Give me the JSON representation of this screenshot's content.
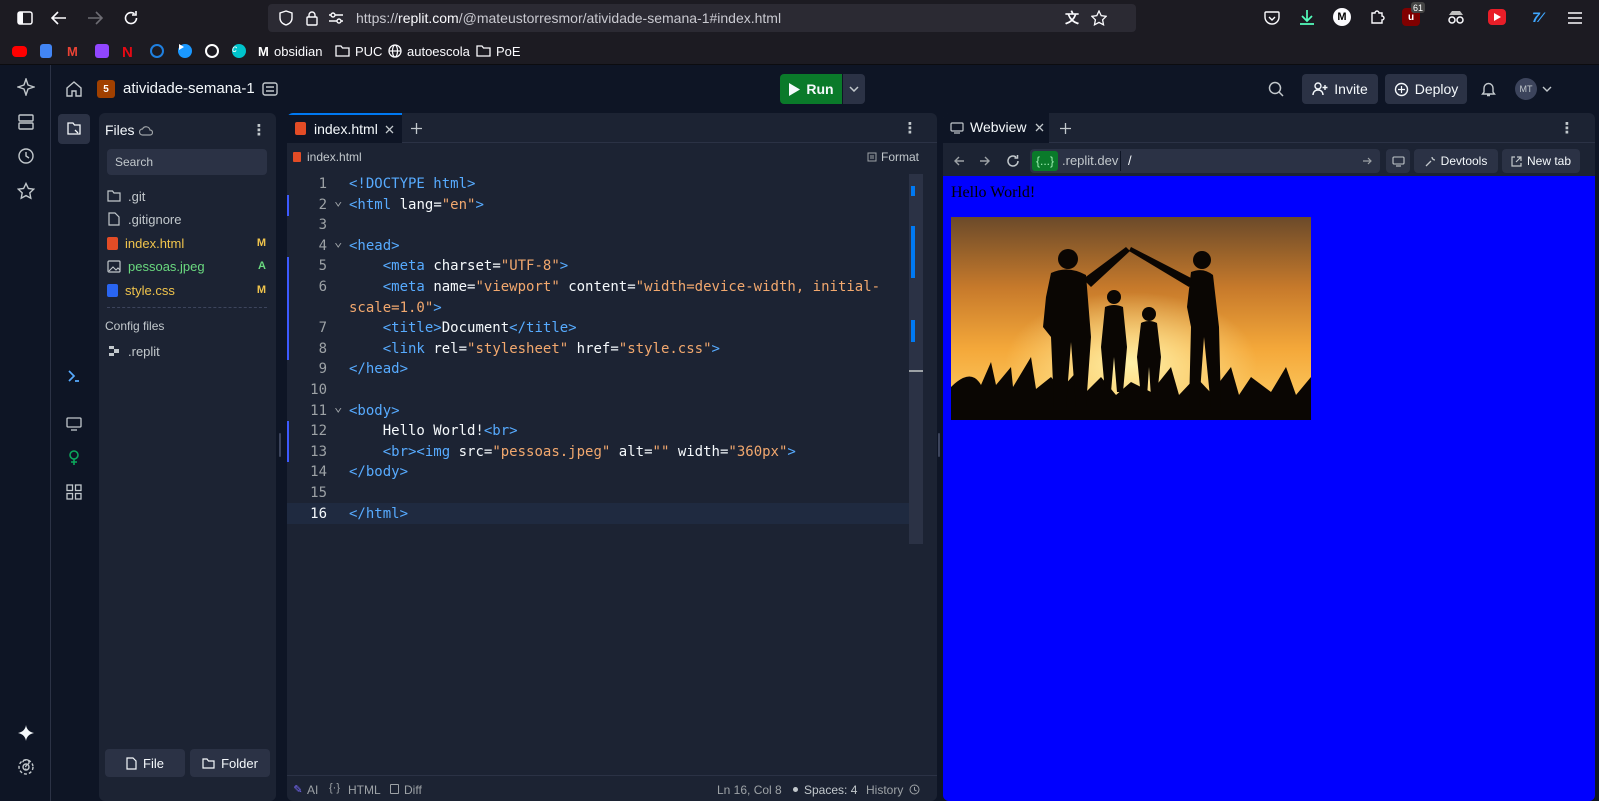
{
  "browser": {
    "url_prefix": "https://",
    "url_host": "replit.com",
    "url_path": "/@mateustorresmor/atividade-semana-1#index.html",
    "notification_count": "61",
    "bookmarks": [
      {
        "label": "",
        "icon": "youtube-icon",
        "color": "#ff0000"
      },
      {
        "label": "",
        "icon": "docs-icon",
        "color": "#4285f4"
      },
      {
        "label": "",
        "icon": "gmail-icon",
        "color": "#ea4335"
      },
      {
        "label": "",
        "icon": "twitch-icon",
        "color": "#9146ff"
      },
      {
        "label": "",
        "icon": "netflix-icon",
        "color": "#e50914"
      },
      {
        "label": "",
        "icon": "disney-icon",
        "color": "#1f80e0"
      },
      {
        "label": "",
        "icon": "prime-icon",
        "color": "#1a98ff"
      },
      {
        "label": "",
        "icon": "openai-icon",
        "color": "#ffffff"
      },
      {
        "label": "",
        "icon": "canva-icon",
        "color": "#00c4cc"
      },
      {
        "label": "obsidian",
        "icon": "medium-icon",
        "color": "#ffffff"
      },
      {
        "label": "PUC",
        "icon": "folder-icon",
        "color": "#fbfbfe"
      },
      {
        "label": "autoescola",
        "icon": "globe-icon",
        "color": "#fbfbfe"
      },
      {
        "label": "PoE",
        "icon": "folder-icon",
        "color": "#fbfbfe"
      }
    ]
  },
  "topbar": {
    "repl_name": "atividade-semana-1",
    "run_label": "Run",
    "invite_label": "Invite",
    "deploy_label": "Deploy",
    "avatar_initials": "MT"
  },
  "files": {
    "title": "Files",
    "search_placeholder": "Search",
    "items": [
      {
        "name": ".git",
        "badge": "",
        "color": "#c2c8cc",
        "icon": "folder-icon"
      },
      {
        "name": ".gitignore",
        "badge": "",
        "color": "#c2c8cc",
        "icon": "file-icon"
      },
      {
        "name": "index.html",
        "badge": "M",
        "color": "#f0c44c",
        "icon": "html-icon"
      },
      {
        "name": "pessoas.jpeg",
        "badge": "A",
        "color": "#6ad97f",
        "icon": "image-icon"
      },
      {
        "name": "style.css",
        "badge": "M",
        "color": "#f0c44c",
        "icon": "css-icon"
      }
    ],
    "config_title": "Config files",
    "config_items": [
      {
        "name": ".replit"
      }
    ],
    "new_file_label": "File",
    "new_folder_label": "Folder"
  },
  "editor": {
    "tab_label": "index.html",
    "breadcrumb": "index.html",
    "format_label": "Format",
    "status": {
      "ai": "AI",
      "lang": "HTML",
      "diff": "Diff",
      "position": "Ln 16, Col 8",
      "spaces": "Spaces: 4",
      "history": "History"
    },
    "lines": [
      {
        "n": "1",
        "html": "<span class=\"t\">&lt;!DOCTYPE html&gt;</span>"
      },
      {
        "n": "2",
        "fold": true,
        "html": "<span class=\"t\">&lt;html</span> <span class=\"a\">lang</span>=<span class=\"s\">\"en\"</span><span class=\"t\">&gt;</span>"
      },
      {
        "n": "3",
        "html": ""
      },
      {
        "n": "4",
        "fold": true,
        "html": "<span class=\"t\">&lt;head&gt;</span>"
      },
      {
        "n": "5",
        "html": "    <span class=\"t\">&lt;meta</span> <span class=\"a\">charset</span>=<span class=\"s\">\"UTF-8\"</span><span class=\"t\">&gt;</span>"
      },
      {
        "n": "6",
        "html": "    <span class=\"t\">&lt;meta</span> <span class=\"a\">name</span>=<span class=\"s\">\"viewport\"</span> <span class=\"a\">content</span>=<span class=\"s\">\"width=device-width, initial-</span>"
      },
      {
        "n": "",
        "html": "<span class=\"s\">scale=1.0\"</span><span class=\"t\">&gt;</span>"
      },
      {
        "n": "7",
        "html": "    <span class=\"t\">&lt;title&gt;</span>Document<span class=\"t\">&lt;/title&gt;</span>"
      },
      {
        "n": "8",
        "html": "    <span class=\"t\">&lt;link</span> <span class=\"a\">rel</span>=<span class=\"s\">\"stylesheet\"</span> <span class=\"a\">href</span>=<span class=\"s\">\"style.css\"</span><span class=\"t\">&gt;</span>"
      },
      {
        "n": "9",
        "html": "<span class=\"t\">&lt;/head&gt;</span>"
      },
      {
        "n": "10",
        "html": ""
      },
      {
        "n": "11",
        "fold": true,
        "html": "<span class=\"t\">&lt;body&gt;</span>"
      },
      {
        "n": "12",
        "html": "    Hello World!<span class=\"t\">&lt;br&gt;</span>"
      },
      {
        "n": "13",
        "html": "    <span class=\"t\">&lt;br&gt;&lt;img</span> <span class=\"a\">src</span>=<span class=\"s\">\"pessoas.jpeg\"</span> <span class=\"a\">alt</span>=<span class=\"s\">\"\"</span> <span class=\"a\">width</span>=<span class=\"s\">\"360px\"</span><span class=\"t\">&gt;</span>"
      },
      {
        "n": "14",
        "html": "<span class=\"t\">&lt;/body&gt;</span>"
      },
      {
        "n": "15",
        "html": ""
      },
      {
        "n": "16",
        "html": "<span class=\"t\">&lt;/html&gt;</span>"
      }
    ]
  },
  "webview": {
    "tab_label": "Webview",
    "domain_badge": "{...}",
    "domain_suffix": ".replit.dev",
    "path": "/",
    "devtools_label": "Devtools",
    "newtab_label": "New tab",
    "page_text": "Hello World!",
    "page_bg": "#0000ff"
  }
}
